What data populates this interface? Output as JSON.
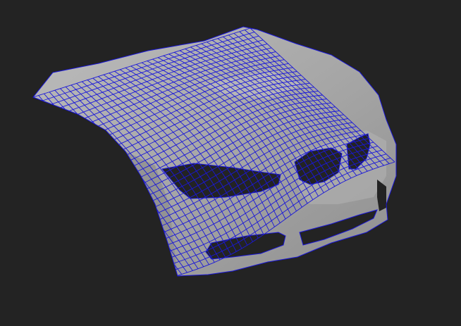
{
  "viewport": {
    "background_color": "#232323",
    "object_fill_color": "#aaaaaa",
    "object_shade_color": "#6f6f6f",
    "highlight_color": "#c8c8c8",
    "wireframe_color": "#1a17d8",
    "object": "car-front-bumper-hood-mesh",
    "display_mode": "smooth-shaded-with-wireframe"
  }
}
